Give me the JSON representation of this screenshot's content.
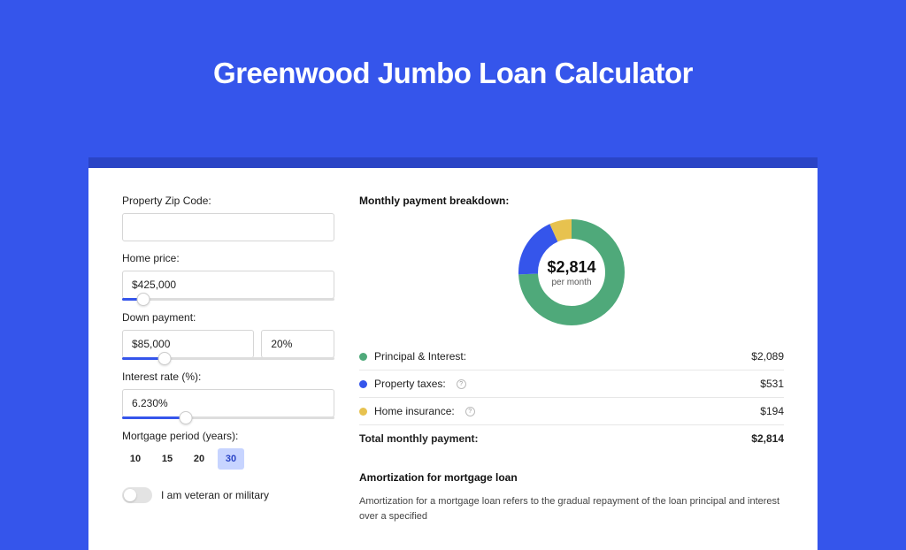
{
  "page_title": "Greenwood Jumbo Loan Calculator",
  "form": {
    "zip_label": "Property Zip Code:",
    "zip_value": "",
    "home_price_label": "Home price:",
    "home_price_value": "$425,000",
    "home_price_slider_pct": 10,
    "down_payment_label": "Down payment:",
    "down_payment_value": "$85,000",
    "down_payment_pct": "20%",
    "down_payment_slider_pct": 20,
    "interest_label": "Interest rate (%):",
    "interest_value": "6.230%",
    "interest_slider_pct": 30,
    "period_label": "Mortgage period (years):",
    "periods": [
      "10",
      "15",
      "20",
      "30"
    ],
    "period_active_index": 3,
    "veteran_label": "I am veteran or military",
    "veteran_on": false
  },
  "breakdown": {
    "heading": "Monthly payment breakdown:",
    "donut_amount": "$2,814",
    "donut_sub": "per month",
    "rows": [
      {
        "color": "green",
        "label": "Principal & Interest:",
        "info": false,
        "value": "$2,089"
      },
      {
        "color": "blue",
        "label": "Property taxes:",
        "info": true,
        "value": "$531"
      },
      {
        "color": "yellow",
        "label": "Home insurance:",
        "info": true,
        "value": "$194"
      }
    ],
    "total_label": "Total monthly payment:",
    "total_value": "$2,814"
  },
  "amortization": {
    "title": "Amortization for mortgage loan",
    "text": "Amortization for a mortgage loan refers to the gradual repayment of the loan principal and interest over a specified"
  },
  "chart_data": {
    "type": "pie",
    "title": "Monthly payment breakdown",
    "series": [
      {
        "name": "Principal & Interest",
        "value": 2089,
        "color": "#4fa97a"
      },
      {
        "name": "Property taxes",
        "value": 531,
        "color": "#3555eb"
      },
      {
        "name": "Home insurance",
        "value": 194,
        "color": "#e7c24f"
      }
    ],
    "total": 2814
  }
}
